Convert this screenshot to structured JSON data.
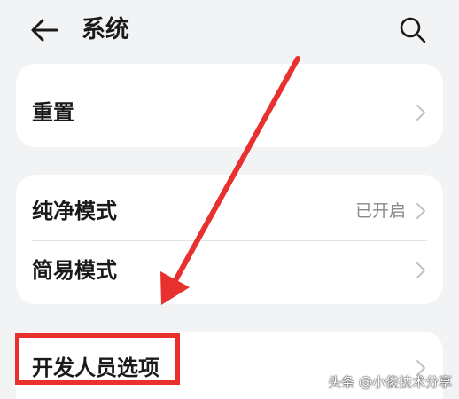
{
  "header": {
    "title": "系统"
  },
  "cards": [
    {
      "rows": [
        {
          "label": "重置",
          "value": ""
        }
      ]
    },
    {
      "rows": [
        {
          "label": "纯净模式",
          "value": "已开启"
        },
        {
          "label": "简易模式",
          "value": ""
        }
      ]
    },
    {
      "rows": [
        {
          "label": "开发人员选项",
          "value": ""
        }
      ]
    }
  ],
  "watermark": "头条 @小俊技术分享",
  "colors": {
    "annotation": "#e8312f",
    "background": "#f1f3f5",
    "card": "#ffffff"
  },
  "icons": {
    "back": "arrow-left-icon",
    "search": "search-icon",
    "row": "chevron-right-icon"
  }
}
